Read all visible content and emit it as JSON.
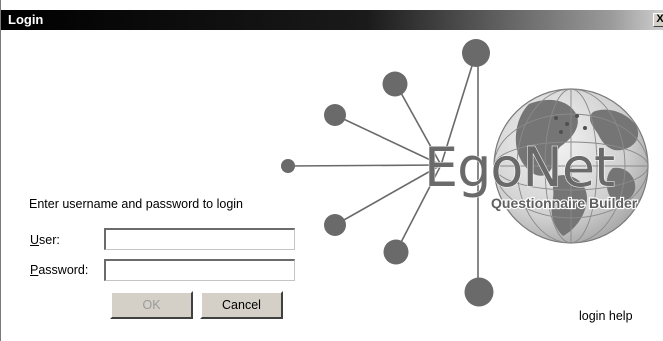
{
  "window": {
    "title": "Login",
    "close_glyph": "X"
  },
  "logo": {
    "brand_name": "EgoNet",
    "product_name": "Questionnaire Builder"
  },
  "form": {
    "prompt": "Enter username and password to login",
    "user_label_mnemonic": "U",
    "user_label_rest": "ser:",
    "user_value": "",
    "password_label_mnemonic": "P",
    "password_label_rest": "assword:",
    "password_value": ""
  },
  "buttons": {
    "ok_label": "OK",
    "cancel_label": "Cancel"
  },
  "help": {
    "link_label": "login help"
  },
  "colors": {
    "titlebar": "#000000",
    "button_face": "#d4d0c8",
    "disabled_text": "#9a9a9a",
    "logo_gray": "#6a6a6a"
  },
  "icons": {
    "close": "close-icon",
    "logo": "egonet-network-globe-logo"
  }
}
